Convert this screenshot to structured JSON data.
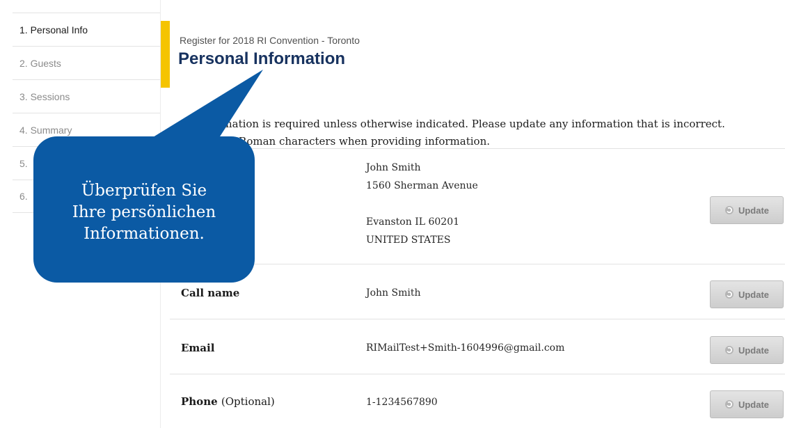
{
  "sidebar": {
    "items": [
      {
        "label": "1. Personal Info"
      },
      {
        "label": "2. Guests"
      },
      {
        "label": "3. Sessions"
      },
      {
        "label": "4. Summary"
      },
      {
        "label": "5."
      },
      {
        "label": "6."
      }
    ]
  },
  "header": {
    "subtitle": "Register for 2018 RI Convention - Toronto",
    "title": "Personal Information"
  },
  "intro": {
    "line1": "All information is required unless otherwise indicated. Please update any information that is incorrect.",
    "line2": "Please use Roman characters when providing information."
  },
  "rows": {
    "address": {
      "line1": "John Smith",
      "line2": "1560 Sherman Avenue",
      "line3": "Evanston IL 60201",
      "line4": "UNITED STATES"
    },
    "call_name": {
      "label": "Call name",
      "value": "John Smith"
    },
    "email": {
      "label": "Email",
      "value": "RIMailTest+Smith-1604996@gmail.com"
    },
    "phone": {
      "label": "Phone",
      "optional": "(Optional)",
      "value": "1-1234567890"
    }
  },
  "buttons": {
    "update_label": "Update"
  },
  "callout": {
    "line1": "Überprüfen Sie",
    "line2": "Ihre persönlichen",
    "line3": "Informationen."
  },
  "colors": {
    "accent": "#f5c400",
    "title": "#17325f",
    "callout": "#0b5aa4"
  }
}
